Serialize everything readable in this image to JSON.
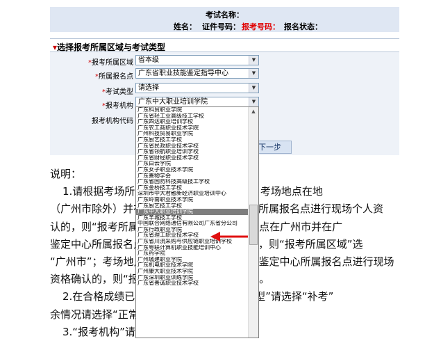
{
  "header": {
    "exam_name_label": "考试名称：",
    "name_label": "姓名：",
    "id_label": "证件号码：",
    "signup_no_label": "报考号码：",
    "status_label": "报名状态："
  },
  "section": {
    "title": "选择报考所属区域与考试类型",
    "title_mark": "▾"
  },
  "form": {
    "area": {
      "label": "*报考所属区域",
      "value": "省本级"
    },
    "point": {
      "label": "*所属报名点",
      "value": "广东省职业技能鉴定指导中心"
    },
    "type": {
      "label": "*考试类型",
      "value": "请选择"
    },
    "org": {
      "label": "*报考机构",
      "value": "广东中大职业培训学院"
    },
    "org_code": {
      "label": "报考机构代码"
    }
  },
  "dropdown": {
    "options": [
      "广东科贸职业学院",
      "广东省轻工业高级技工学校",
      "广东四达职业培训学校",
      "广东农工商职业技术学院",
      "广州科技贸易职业学院",
      "广东厨艺技工学校",
      "广东省民政职业技术学校",
      "广东省领航职业培训学校",
      "广东省财经职业技术学校",
      "广东白云学院",
      "广东女子职业技术学院",
      "广东善物学会",
      "广东省国防科技高级技工学校",
      "广东金桥技工学校",
      "深圳市中大君融新经济职业培训中心",
      "广东岭南职业技术学院",
      "广东厨艺技工学校",
      "广东中大职业培训学院",
      "广东羊城技工学校",
      "中国联合网络通信有限公司广东省分公司",
      "广东行政职业学院",
      "广东省理工职业技术学校",
      "广东省川流采购与供应链职业培训学校",
      "广东粤联计算机职业技能培训中心",
      "广东药学院",
      "广州城建职业学院",
      "广东机电职业技术学院",
      "广州康大职业技术学院",
      "广东深圳职业训练学院",
      "广东省善诚职业技术学校"
    ],
    "selected_index": 17
  },
  "next_button": "下一步",
  "notes": {
    "title": "说明：",
    "lines": [
      "1.请根据考场所在地选择“报考所属区域”。考场地点在地",
      "（广州市除外）并在该地区职业技能鉴定中心所属报名点进行现场个人资",
      "认的，则“报考所属区域”选择“地市”；考场地点在广州市并在广",
      "鉴定中心所属报名点进行现场个人资格确认的，则“报考所属区域”选",
      "“广州市”；考场地点在广州市并在省职业技能鉴定中心所属报名点进行现场",
      "资格确认的，则“报考所属区域”选择“省本级”。",
      "2.在合格成绩已过有效期的人员，“考试类型”请选择“补考”",
      "余情况请选择“正常考试”。",
      "3.“报考机构”请选择您报名时所在的学校。"
    ]
  }
}
